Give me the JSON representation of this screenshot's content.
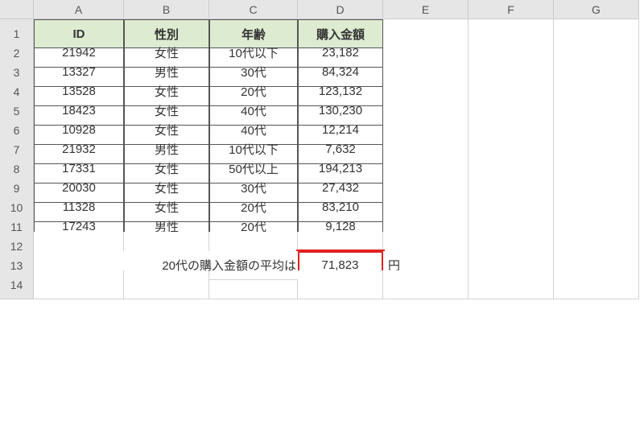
{
  "columns": [
    "A",
    "B",
    "C",
    "D",
    "E",
    "F",
    "G"
  ],
  "row_numbers": [
    "1",
    "2",
    "3",
    "4",
    "5",
    "6",
    "7",
    "8",
    "9",
    "10",
    "11",
    "12",
    "13",
    "14"
  ],
  "headers": {
    "id": "ID",
    "gender": "性別",
    "age": "年齢",
    "amount": "購入金額"
  },
  "rows": [
    {
      "id": "21942",
      "gender": "女性",
      "age": "10代以下",
      "amount": "23,182"
    },
    {
      "id": "13327",
      "gender": "男性",
      "age": "30代",
      "amount": "84,324"
    },
    {
      "id": "13528",
      "gender": "女性",
      "age": "20代",
      "amount": "123,132"
    },
    {
      "id": "18423",
      "gender": "女性",
      "age": "40代",
      "amount": "130,230"
    },
    {
      "id": "10928",
      "gender": "女性",
      "age": "40代",
      "amount": "12,214"
    },
    {
      "id": "21932",
      "gender": "男性",
      "age": "10代以下",
      "amount": "7,632"
    },
    {
      "id": "17331",
      "gender": "女性",
      "age": "50代以上",
      "amount": "194,213"
    },
    {
      "id": "20030",
      "gender": "女性",
      "age": "30代",
      "amount": "27,432"
    },
    {
      "id": "11328",
      "gender": "女性",
      "age": "20代",
      "amount": "83,210"
    },
    {
      "id": "17243",
      "gender": "男性",
      "age": "20代",
      "amount": "9,128"
    }
  ],
  "summary": {
    "label": "20代の購入金額の平均は",
    "value": "71,823",
    "unit": "円"
  }
}
